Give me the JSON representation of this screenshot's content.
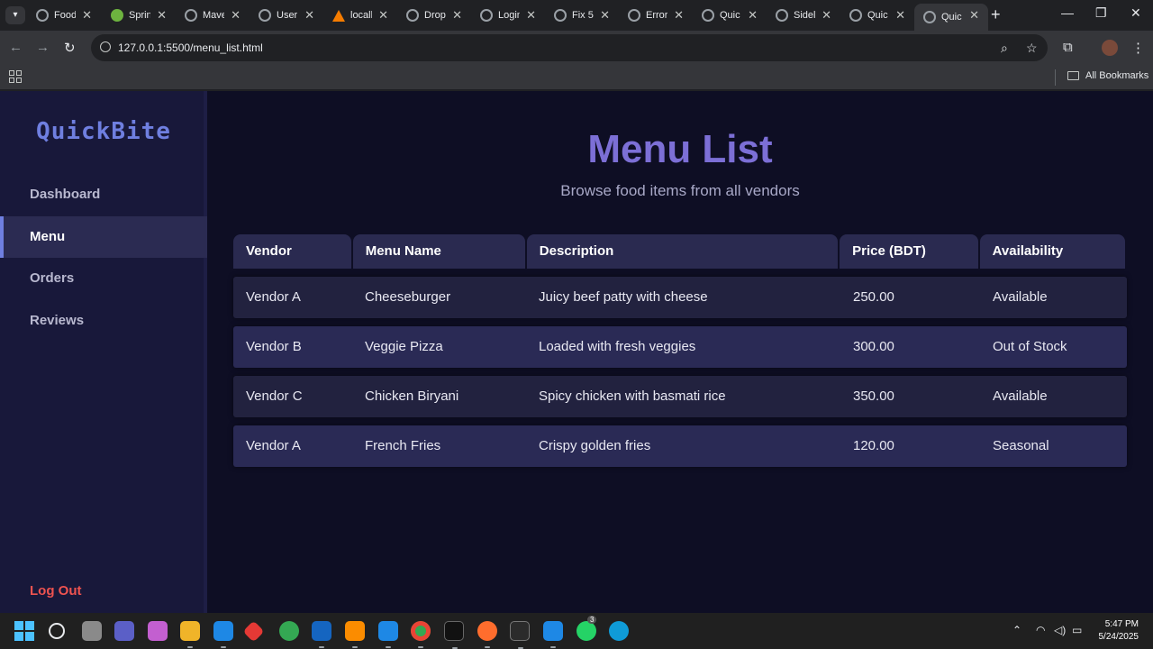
{
  "browser": {
    "tabs": [
      {
        "title": "Food",
        "icon": "globe-icon"
      },
      {
        "title": "Sprin",
        "icon": "spring-icon"
      },
      {
        "title": "Mave",
        "icon": "globe-icon"
      },
      {
        "title": "User",
        "icon": "globe-icon"
      },
      {
        "title": "locall",
        "icon": "xampp-icon"
      },
      {
        "title": "Drop",
        "icon": "globe-icon"
      },
      {
        "title": "Login",
        "icon": "globe-icon"
      },
      {
        "title": "Fix 5(",
        "icon": "globe-icon"
      },
      {
        "title": "Error",
        "icon": "globe-icon"
      },
      {
        "title": "Quic",
        "icon": "globe-icon"
      },
      {
        "title": "Sidel",
        "icon": "globe-icon"
      },
      {
        "title": "Quic",
        "icon": "globe-icon"
      },
      {
        "title": "Quic",
        "icon": "globe-icon"
      }
    ],
    "url": "127.0.0.1:5500/menu_list.html",
    "bookmarks_label": "All Bookmarks"
  },
  "sidebar": {
    "brand": "QuickBite",
    "items": [
      {
        "label": "Dashboard"
      },
      {
        "label": "Menu"
      },
      {
        "label": "Orders"
      },
      {
        "label": "Reviews"
      }
    ],
    "active": "Menu",
    "logout": "Log Out"
  },
  "main": {
    "title": "Menu List",
    "subtitle": "Browse food items from all vendors"
  },
  "table": {
    "headers": [
      "Vendor",
      "Menu Name",
      "Description",
      "Price (BDT)",
      "Availability"
    ],
    "rows": [
      [
        "Vendor A",
        "Cheeseburger",
        "Juicy beef patty with cheese",
        "250.00",
        "Available"
      ],
      [
        "Vendor B",
        "Veggie Pizza",
        "Loaded with fresh veggies",
        "300.00",
        "Out of Stock"
      ],
      [
        "Vendor C",
        "Chicken Biryani",
        "Spicy chicken with basmati rice",
        "350.00",
        "Available"
      ],
      [
        "Vendor A",
        "French Fries",
        "Crispy golden fries",
        "120.00",
        "Seasonal"
      ]
    ]
  },
  "taskbar": {
    "time": "5:47 PM",
    "date": "5/24/2025",
    "whatsapp_badge": "3"
  },
  "colors": {
    "accent": "#7c6fd6",
    "brand": "#6f7fe0",
    "logout": "#ef5350",
    "page_bg": "#0e0e24",
    "sidebar_bg": "#18183a"
  }
}
